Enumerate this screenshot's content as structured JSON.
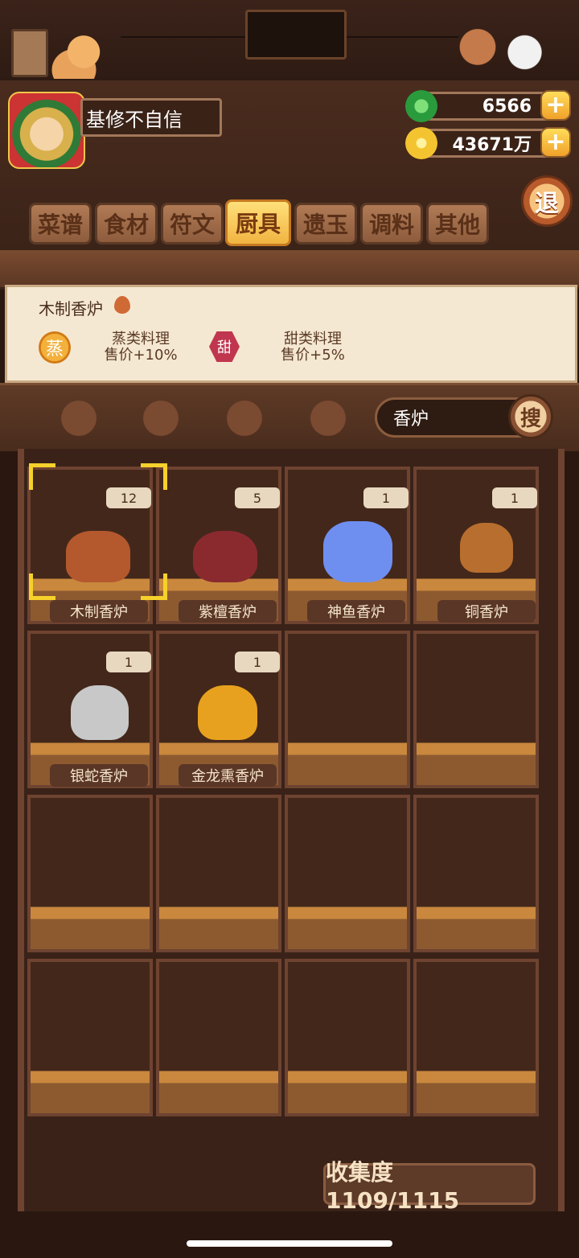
{
  "player": {
    "name": "基修不自信"
  },
  "currency": {
    "jade": "6566",
    "coins": "43671万"
  },
  "exit_label": "退",
  "tabs": [
    {
      "label": "菜谱",
      "active": false
    },
    {
      "label": "食材",
      "active": false
    },
    {
      "label": "符文",
      "active": false
    },
    {
      "label": "厨具",
      "active": true
    },
    {
      "label": "遗玉",
      "active": false
    },
    {
      "label": "调料",
      "active": false
    },
    {
      "label": "其他",
      "active": false
    }
  ],
  "detail": {
    "title": "木制香炉",
    "effects": [
      {
        "badge": "蒸",
        "line1": "蒸类料理",
        "line2": "售价+10%"
      },
      {
        "badge": "甜",
        "line1": "甜类料理",
        "line2": "售价+5%"
      }
    ]
  },
  "filter_icons": [
    "knife-icon",
    "bag-icon",
    "pan-icon",
    "flame-icon"
  ],
  "search": {
    "value": "香炉",
    "button": "搜"
  },
  "items": [
    {
      "name": "木制香炉",
      "count": "12",
      "color": "#b4582e"
    },
    {
      "name": "紫檀香炉",
      "count": "5",
      "color": "#8a2a2f"
    },
    {
      "name": "神鱼香炉",
      "count": "1",
      "color": "#6f8ff0"
    },
    {
      "name": "铜香炉",
      "count": "1",
      "color": "#b86e2e"
    },
    {
      "name": "银蛇香炉",
      "count": "1",
      "color": "#c8c8c8"
    },
    {
      "name": "金龙熏香炉",
      "count": "1",
      "color": "#e8a11e"
    }
  ],
  "collection": "收集度 1109/1115"
}
